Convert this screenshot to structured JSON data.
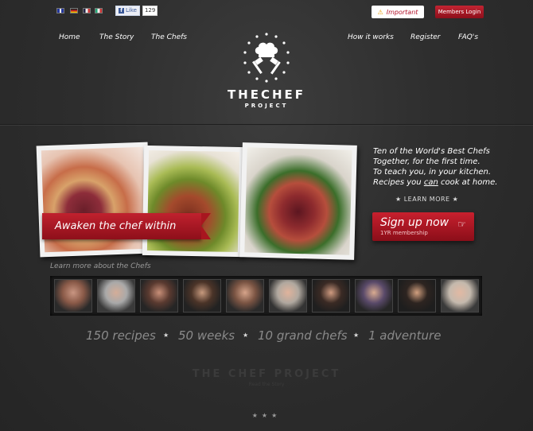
{
  "topbar": {
    "flags": [
      "english-flag",
      "german-flag",
      "french-flag",
      "italian-flag"
    ],
    "facebook": {
      "label": "Like",
      "count": "129"
    },
    "important_label": "Important",
    "members_label": "Members Login"
  },
  "nav": {
    "left": [
      "Home",
      "The Story",
      "The Chefs"
    ],
    "right": [
      "How it works",
      "Register",
      "FAQ's"
    ]
  },
  "logo": {
    "title": "THECHEF",
    "subtitle": "PROJECT"
  },
  "hero": {
    "ribbon": "Awaken the chef within",
    "taglines": [
      "Ten of the World's Best Chefs",
      "Together, for the first time.",
      "To teach you, in your kitchen.",
      "Recipes you can cook at home."
    ],
    "learn_more": "LEARN MORE",
    "signup_title": "Sign up now",
    "signup_sub": "1YR membership"
  },
  "chefs": {
    "label": "Learn more about the Chefs",
    "count": 10
  },
  "stats": [
    "150 recipes",
    "50 weeks",
    "10 grand chefs",
    "1 adventure"
  ],
  "footer": {
    "title": "THE CHEF PROJECT",
    "subtitle": "Read the Story"
  },
  "colors": {
    "accent": "#b3122a",
    "background": "#2e2e2e"
  }
}
